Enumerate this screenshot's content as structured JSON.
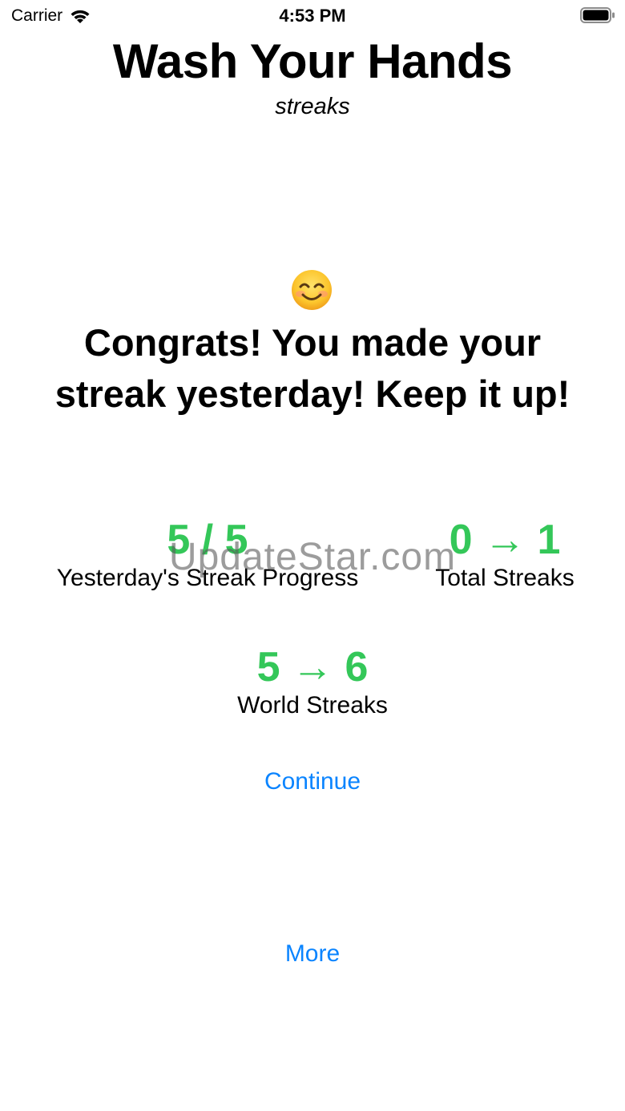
{
  "status_bar": {
    "carrier": "Carrier",
    "time": "4:53 PM",
    "wifi_icon": "wifi-icon",
    "battery_icon": "battery-full-icon"
  },
  "header": {
    "title": "Wash Your Hands",
    "subtitle": "streaks"
  },
  "emoji": {
    "icon": "smiling-face-icon"
  },
  "message": "Congrats!  You made your streak yesterday!  Keep it up!",
  "stats": {
    "yesterday_progress": {
      "value": "5 / 5",
      "label": "Yesterday's Streak Progress"
    },
    "total_streaks": {
      "value": "0 → 1",
      "label": "Total Streaks"
    },
    "world_streaks": {
      "value": "5 → 6",
      "label": "World Streaks"
    }
  },
  "watermark": "UpdateStar.com",
  "buttons": {
    "continue_label": "Continue",
    "more_label": "More"
  },
  "colors": {
    "accent_green": "#34c759",
    "link_blue": "#0a84ff",
    "text": "#000000",
    "background": "#ffffff"
  }
}
